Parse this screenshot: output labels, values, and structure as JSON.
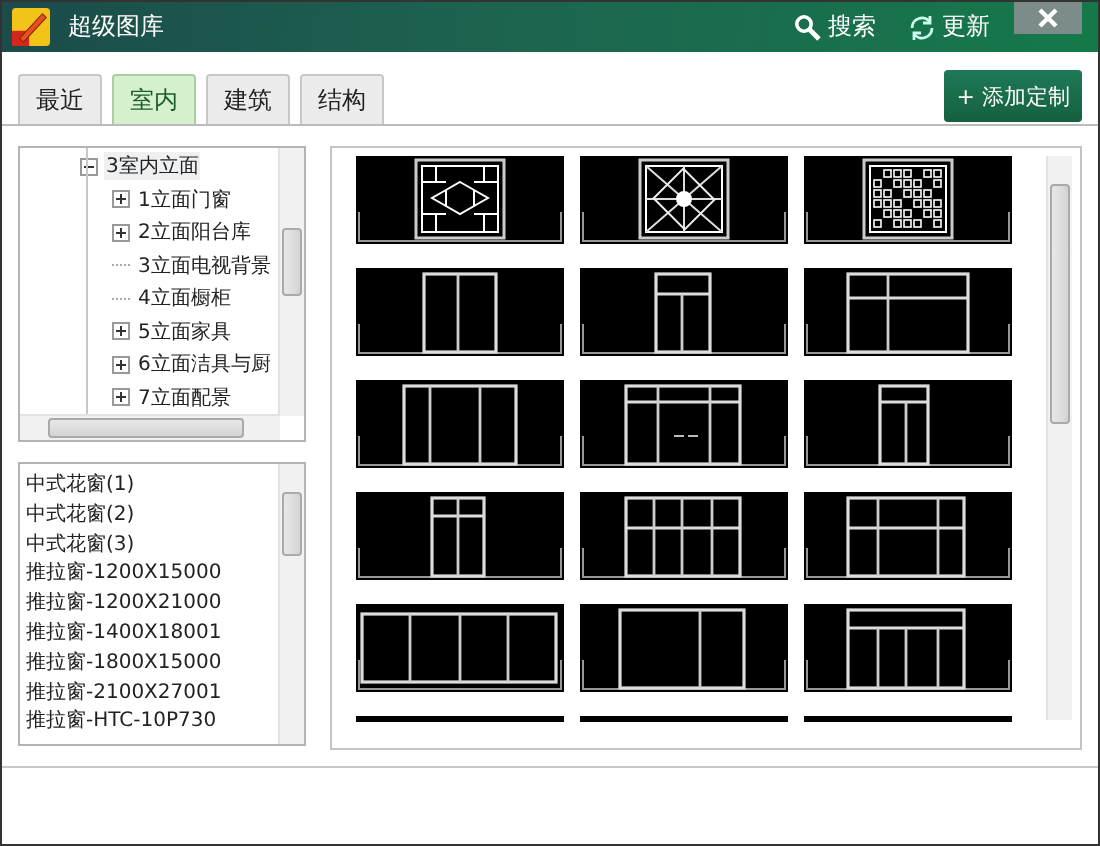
{
  "window": {
    "title": "超级图库"
  },
  "toolbar": [
    {
      "kind": "search",
      "label": "搜索"
    },
    {
      "kind": "refresh",
      "label": "更新"
    }
  ],
  "tabs": [
    {
      "label": "最近",
      "selected": false
    },
    {
      "label": "室内",
      "selected": true
    },
    {
      "label": "建筑",
      "selected": false
    },
    {
      "label": "结构",
      "selected": false
    }
  ],
  "add_button": {
    "label": "+ 添加定制"
  },
  "tree": {
    "items": [
      {
        "label": "3室内立面",
        "kind": "folder",
        "expanded": true,
        "selected": true,
        "children": [
          {
            "label": "1立面门窗",
            "kind": "folder",
            "expanded": false,
            "selected": false
          },
          {
            "label": "2立面阳台库",
            "kind": "folder",
            "expanded": false,
            "selected": false
          },
          {
            "label": "3立面电视背景",
            "kind": "leaf",
            "selected": false
          },
          {
            "label": "4立面橱柜",
            "kind": "leaf",
            "selected": false
          },
          {
            "label": "5立面家具",
            "kind": "folder",
            "expanded": false,
            "selected": false
          },
          {
            "label": "6立面洁具与厨",
            "kind": "folder",
            "expanded": false,
            "selected": false
          },
          {
            "label": "7立面配景",
            "kind": "folder",
            "expanded": false,
            "selected": false
          }
        ]
      }
    ]
  },
  "list": {
    "items": [
      "中式花窗(1)",
      "中式花窗(2)",
      "中式花窗(3)",
      "推拉窗-1200X15000",
      "推拉窗-1200X21000",
      "推拉窗-1400X18001",
      "推拉窗-1800X15000",
      "推拉窗-2100X27001",
      "推拉窗-HTC-10P730"
    ]
  }
}
